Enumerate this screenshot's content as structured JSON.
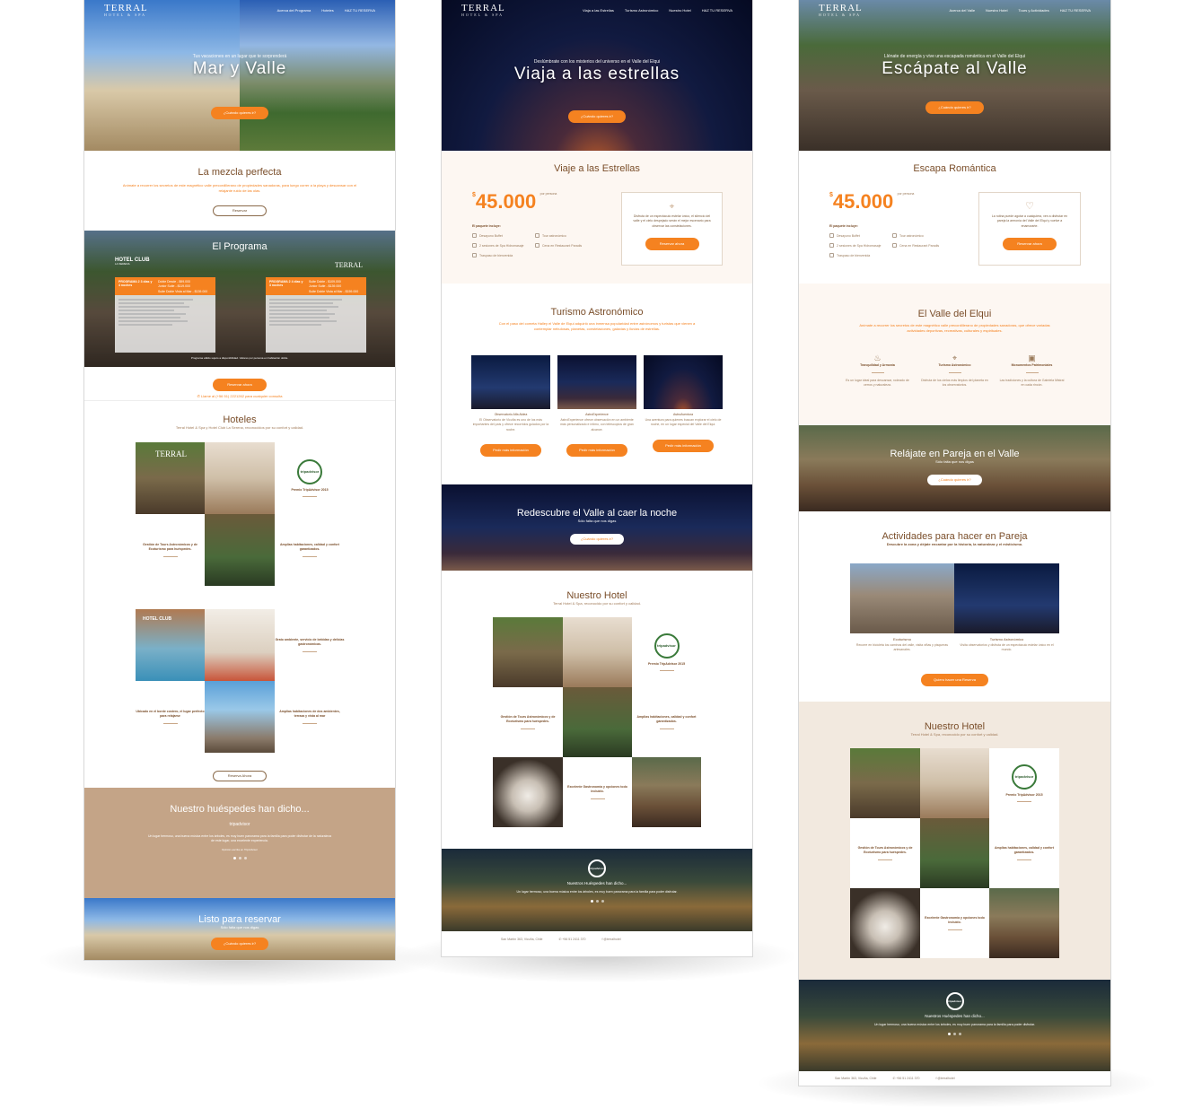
{
  "colors": {
    "accent": "#f58220",
    "brown": "#7a4e2a",
    "beige_section": "#c4a487",
    "cream": "#fdf7f2"
  },
  "nav": {
    "logo": "TERRAL",
    "logo_sub": "HOTEL & SPA",
    "p1_links": [
      "Acerca del Programa",
      "Hoteles",
      "HAZ TU RESERVA"
    ],
    "p2_links": [
      "Viaja a las Estrellas",
      "Turismo Astronómico",
      "Nuestro Hotel",
      "HAZ TU RESERVA"
    ],
    "p3_links": [
      "Acerca del Valle",
      "Nuestro Hotel",
      "Tours y Actividades",
      "HAZ TU RESERVA"
    ]
  },
  "page1": {
    "hero_sub": "Tus vacaciones en un lugar que te sorprenderá",
    "hero_title": "Mar y Valle",
    "hero_button": "¿Cuándo quieres ir?",
    "mix_title": "La mezcla perfecta",
    "mix_text": "Anímate a recorrer los secretos de este magnético valle precordillerano de propiedades sanadoras, para luego correr a la playa y descansar con el relajante ruido de las olas.",
    "mix_button": "Reservar",
    "program_title": "El Programa",
    "hotel_club_logo": "HOTEL CLUB",
    "hotel_club_sub": "LA SERENA",
    "program_a_title": "PROGRAMA 2 3 días y 4 noches",
    "program_a_prices": [
      "Doble Desde - $99.000",
      "Junior Suite - $119.000",
      "Suite Doble Vista al Mar - $139.000"
    ],
    "program_b_title": "PROGRAMA 2 4 días y 3 noches",
    "program_b_prices": [
      "Suite Doble - $109.000",
      "Junior Suite - $139.000",
      "Suite Doble Vista al Mar - $159.000"
    ],
    "program_note": "Programa válido sujeto a disponibilidad. Valores por persona en habitación doble.",
    "program_button": "Reservar ahora",
    "program_phone": "Llame al (+56 51) 2221262 para cualquier consulta",
    "hotels_title": "Hoteles",
    "hotels_sub": "Terral Hotel & Spa y Hotel Club La Serena, reconocidos por su confort y calidad.",
    "award_label": "Premio TripAdvisor 2015",
    "award_badge": "tripadvisor",
    "tile_tours": "Gestión de Tours Astronómicos y de Ecoturismo para huéspedes.",
    "tile_rooms": "Amplias habitaciones, calidad y confort garantizados.",
    "tile_gastro": "Grato ambiente, servicio de bebidas y delicias gastronómicas.",
    "tile_coast": "Ubicado en el borde costero, el lugar perfecto para relajarse",
    "tile_rooms2": "Amplias habitaciones de dos ambientes, terraza y vista al mar",
    "hotels_button": "Reserva Ahora",
    "guests_title": "Nuestro huéspedes han dicho...",
    "guests_brand": "tripadvisor",
    "guests_quote": "Un lugar hermoso, una buena música entre los árboles, es muy buen panorama para la familia para poder disfrutar de la naturaleza de este lugar, una excelente experiencia.",
    "guests_author": "Opinión escrita en TripAdvisor",
    "final_title": "Listo para reservar",
    "final_sub": "Sólo falta que nos digas",
    "final_button": "¿Cuándo quieres ir?"
  },
  "page2": {
    "hero_sub": "Deslúmbrate con los misterios del universo en el Valle del Elqui",
    "hero_title": "Viaja a las estrellas",
    "hero_button": "¿Cuándo quieres ir?",
    "offer_title": "Viaje a las Estrellas",
    "price": "45.000",
    "price_unit": "por persona",
    "includes_label": "El paquete incluye:",
    "includes": [
      "Desayuno Buffet",
      "Tour astronómico",
      "2 sesiones de Spa Hidromasaje",
      "Cena en Restaurant Paradis",
      "Traspaso de bienvenida"
    ],
    "card_text": "Disfruta de un espectáculo estelar único, el silencio del valle y el cielo despejado serán el mejor escenario para observar las constelaciones.",
    "card_button": "Reservar ahora",
    "astro_title": "Turismo Astronómico",
    "astro_text": "Con el paso del cometa Halley el Valle de Elqui adquirió una inmensa popularidad entre astrónomos y turistas que vienen a contemplar nebulosas, planetas, constelaciones, galaxias y lluvias de estrellas.",
    "astro_cards": [
      {
        "name": "Observatorio Alfa Aldea",
        "text": "El Observatorio de Vicuña es uno de los más importantes del país y ofrece recorridos guiados por la noche.",
        "button": "Pedir más información"
      },
      {
        "name": "AstroExperience",
        "text": "AstroExperience ofrece observación en un ambiente más personalizado e íntimo, con telescopios de gran alcance.",
        "button": "Pedir más información"
      },
      {
        "name": "AstroAventura",
        "text": "Una aventura para quienes buscan explorar el cielo de noche, en un lugar especial del Valle del Elqui.",
        "button": "Pedir más información"
      }
    ],
    "night_title": "Redescubre el Valle al caer la noche",
    "night_sub": "Sólo falta que nos digas",
    "night_button": "¿Cuándo quieres ir?",
    "hotel_title": "Nuestro Hotel",
    "hotel_sub": "Terral Hotel & Spa, reconocido por su confort y calidad.",
    "award_label": "Premio TripAdvisor 2015",
    "award_badge": "tripadvisor",
    "tile_tours": "Gestión de Tours Astronómicos y de Ecoturismo para huéspedes.",
    "tile_rooms": "Amplias habitaciones, calidad y confort garantizados.",
    "tile_gastro": "Excelente Gastronomía y opciones todo incluido.",
    "guests_title": "Nuestros Huéspedes han dicho...",
    "guests_quote": "Un lugar hermoso, una buena música entre los árboles, es muy buen panorama para la familia para poder disfrutar.",
    "footer_address": "San Martín 363, Vicuña, Chile",
    "footer_phone": "+56 51 2411 370",
    "footer_social": "@terralhotel"
  },
  "page3": {
    "hero_sub": "Llénate de energía y vive una escapada romántica en el Valle del Elqui",
    "hero_title": "Escápate al Valle",
    "hero_button": "¿Cuándo quieres ir?",
    "offer_title": "Escapa Romántica",
    "price": "45.000",
    "price_unit": "por persona",
    "includes_label": "El paquete incluye:",
    "includes": [
      "Desayuno Buffet",
      "Tour astronómico",
      "2 sesiones de Spa Hidromasaje",
      "Cena en Restaurant Paradis",
      "Traspaso de bienvenida"
    ],
    "card_text": "La rutina puede agotar a cualquiera, ven a disfrutar en pareja la armonía del Valle del Elqui y vuelve a enamorarte.",
    "card_button": "Reservar ahora",
    "valley_title": "El Valle del Elqui",
    "valley_text": "Anímate a recorrer los secretos de este magnético valle precordillerano de propiedades sanadoras, que ofrece variadas actividades deportivas, recreativas, culturales y espirituales.",
    "features": [
      {
        "name": "Tranquilidad y Armonía",
        "text": "Es un lugar ideal para descansar, rodeado de cerros y naturaleza."
      },
      {
        "name": "Turismo Astronómico",
        "text": "Disfruta de los cielos más limpios del planeta en los observatorios."
      },
      {
        "name": "Monumentos Patrimoniales",
        "text": "Las tradiciones y la cultura de Gabriela Mistral en cada rincón."
      }
    ],
    "relax_title": "Relájate en Pareja en el Valle",
    "relax_sub": "Sólo falta que nos digas",
    "relax_button": "¿Cuándo quieres ir?",
    "activities_title": "Actividades para hacer en Pareja",
    "activities_sub": "Descubre la zona y déjate encantar por la historia, la naturaleza y el misticismo.",
    "activities": [
      {
        "name": "Ecoturismo",
        "text": "Recorre en bicicleta los caminos del valle, visita viñas y pisqueras artesanales."
      },
      {
        "name": "Turismo Astronómico",
        "text": "Visita observatorios y disfruta de un espectáculo estelar único en el mundo."
      }
    ],
    "activities_button": "Quiero hacer una Reserva",
    "hotel_title": "Nuestro Hotel",
    "hotel_sub": "Terral Hotel & Spa, reconocido por su confort y calidad.",
    "award_label": "Premio TripAdvisor 2015",
    "award_badge": "tripadvisor",
    "tile_tours": "Gestión de Tours Astronómicos y de Ecoturismo para huéspedes.",
    "tile_rooms": "Amplias habitaciones, calidad y confort garantizados.",
    "tile_gastro": "Excelente Gastronomía y opciones todo incluido.",
    "guests_title": "Nuestros Huéspedes han dicho...",
    "guests_quote": "Un lugar hermoso, una buena música entre los árboles, es muy buen panorama para la familia para poder disfrutar.",
    "footer_address": "San Martín 363, Vicuña, Chile",
    "footer_phone": "+56 51 2411 370",
    "footer_social": "@terralhotel"
  }
}
